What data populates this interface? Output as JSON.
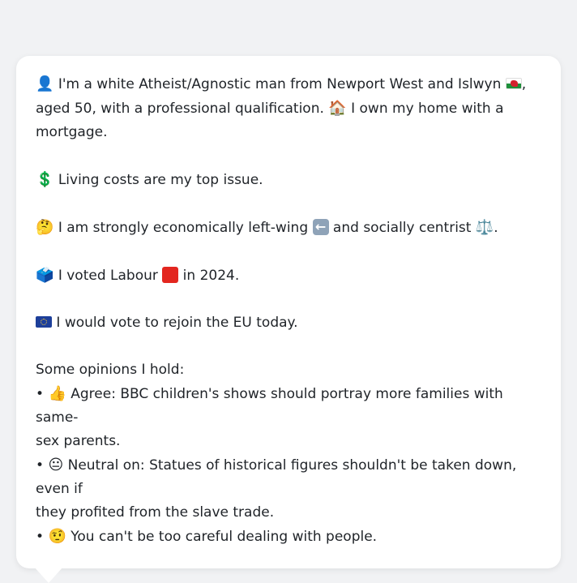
{
  "message": {
    "intro": {
      "icon_person": "👤",
      "text_a": " I'm a white Atheist/Agnostic man from Newport West and Islwyn ",
      "flag_wales": "wales-flag-icon",
      "text_b": ",",
      "text_c": "aged 50, with a professional qualification. ",
      "icon_house": "🏠",
      "text_d": " I own my home with a",
      "text_e": "mortgage."
    },
    "issue": {
      "icon": "💲",
      "text": " Living costs are my top issue."
    },
    "ideology": {
      "icon": "🤔",
      "text_a": " I am strongly economically left-wing ",
      "arrow_icon": "left-arrow-icon",
      "text_b": " and socially centrist ",
      "scales_icon": "⚖️",
      "text_c": "."
    },
    "vote": {
      "icon": "🗳️",
      "text_a": " I voted Labour ",
      "square_icon": "red-square-icon",
      "text_b": " in 2024."
    },
    "eu": {
      "flag_icon": "eu-flag-icon",
      "text": " I would vote to rejoin the EU today."
    },
    "opinions": {
      "heading": "Some opinions I hold:",
      "items": [
        {
          "bullet": "•",
          "icon": "👍",
          "line1": " Agree: BBC children's shows should portray more families with same-",
          "line2": "sex parents."
        },
        {
          "bullet": "•",
          "icon": "😐",
          "line1": " Neutral on: Statues of historical figures shouldn't be taken down, even if",
          "line2": "they profited from the slave trade."
        },
        {
          "bullet": "•",
          "icon": "🤨",
          "line1": " You can't be too careful dealing with people.",
          "line2": ""
        }
      ]
    }
  }
}
